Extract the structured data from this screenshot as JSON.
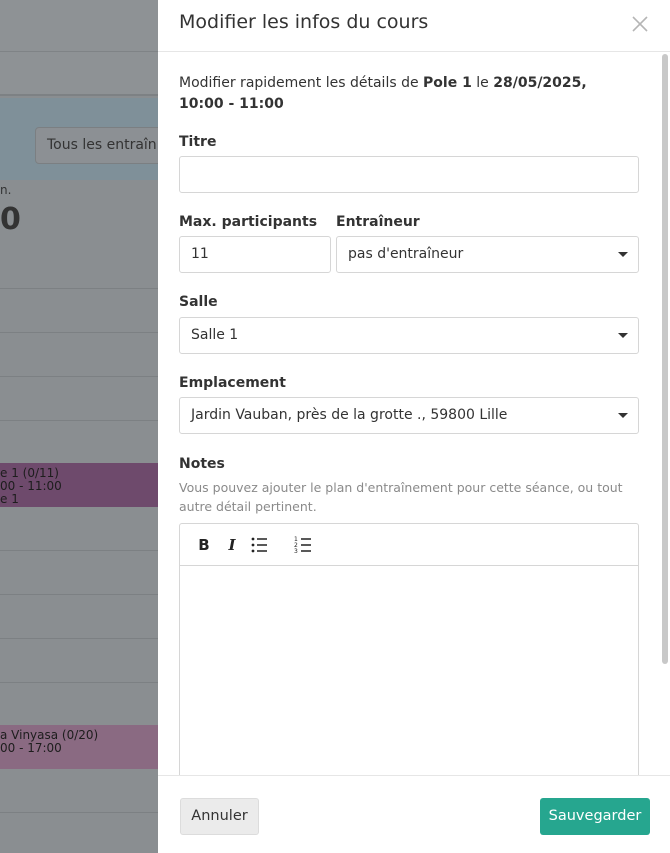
{
  "background": {
    "filter_label": "Tous les entraîn",
    "stat_suffix": "n.",
    "stat_value": "0",
    "event1": {
      "line1": "e 1 (0/11)",
      "line2": "00 - 11:00",
      "line3": "e 1"
    },
    "event2": {
      "line1": "a Vinyasa (0/20)",
      "line2": "00 - 17:00"
    }
  },
  "drawer": {
    "title": "Modifier les infos du cours",
    "close_icon": "close-icon",
    "intro": {
      "prefix": "Modifier rapidement les détails de ",
      "course": "Pole 1",
      "middle": " le ",
      "datetime": "28/05/2025, 10:00 - 11:00"
    },
    "fields": {
      "title": {
        "label": "Titre",
        "value": "",
        "placeholder": ""
      },
      "max_participants": {
        "label": "Max. participants",
        "value": "11"
      },
      "trainer": {
        "label": "Entraîneur",
        "value": "pas d'entraîneur"
      },
      "room": {
        "label": "Salle",
        "value": "Salle 1"
      },
      "location": {
        "label": "Emplacement",
        "value": "Jardin Vauban, près de la grotte ., 59800 Lille"
      },
      "notes": {
        "label": "Notes",
        "hint": "Vous pouvez ajouter le plan d'entraînement pour cette séance, ou tout autre détail pertinent.",
        "toolbar": {
          "bold": "B",
          "italic": "I",
          "bullet_icon": "bullet-list-icon",
          "ordered_icon": "ordered-list-icon"
        },
        "value": ""
      }
    },
    "footer": {
      "cancel_label": "Annuler",
      "save_label": "Sauvegarder"
    }
  },
  "colors": {
    "accent": "#26a68f",
    "overlay": "#8a8e91"
  }
}
